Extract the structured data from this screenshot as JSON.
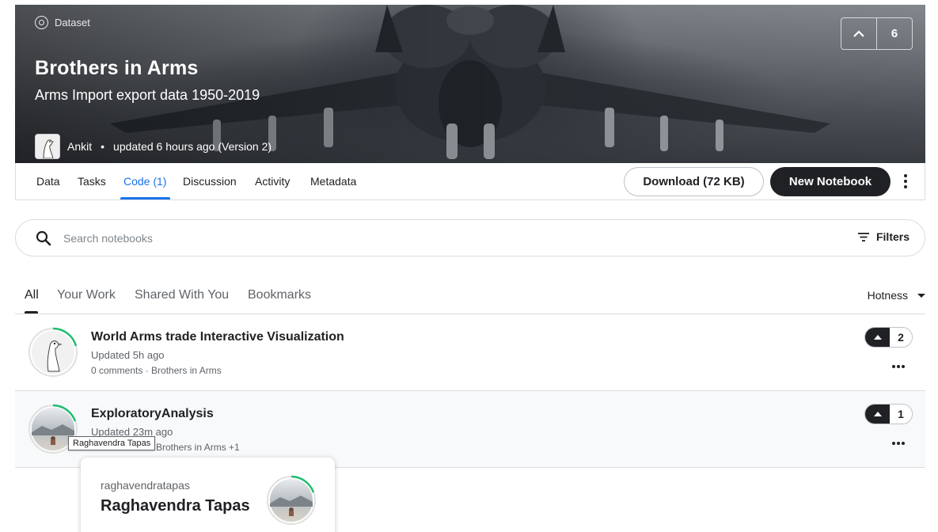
{
  "hero": {
    "tag": "Dataset",
    "tag_icon": "dataset-icon",
    "title": "Brothers in Arms",
    "subtitle": "Arms Import export data 1950-2019",
    "owner_name": "Ankit",
    "updated_text": "updated 6 hours ago (Version 2)",
    "upvotes": "6"
  },
  "tabs": [
    "Data",
    "Tasks",
    "Code (1)",
    "Discussion",
    "Activity",
    "Metadata"
  ],
  "active_tab": "Code (1)",
  "actions": {
    "download_label": "Download (72 KB)",
    "new_notebook_label": "New Notebook"
  },
  "search": {
    "placeholder": "Search notebooks",
    "filters_label": "Filters"
  },
  "subtabs": [
    "All",
    "Your Work",
    "Shared With You",
    "Bookmarks"
  ],
  "sort_label": "Hotness",
  "notebooks": [
    {
      "title": "World Arms trade Interactive Visualization",
      "updated": "Updated 5h ago",
      "meta": "0 comments · Brothers in Arms",
      "votes": "2"
    },
    {
      "title": "ExploratoryAnalysis",
      "updated": "Updated 23m ago",
      "meta": "Brothers in Arms +1",
      "votes": "1"
    }
  ],
  "tooltip": "Raghavendra Tapas",
  "hovercard": {
    "username": "raghavendratapas",
    "display_name": "Raghavendra Tapas"
  },
  "colors": {
    "accent_blue": "#1a73e8",
    "progress_green": "#20BEFF",
    "dark": "#202124"
  }
}
